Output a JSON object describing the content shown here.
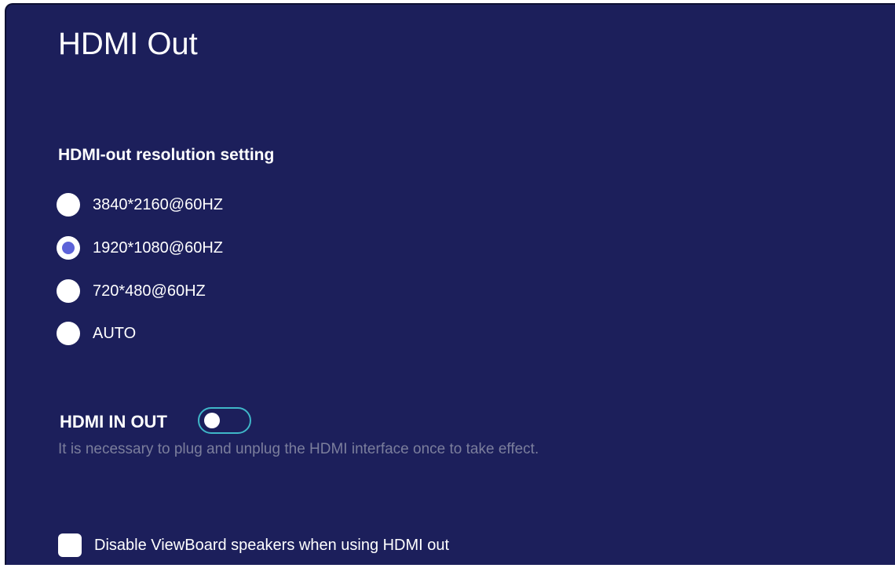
{
  "page": {
    "title": "HDMI Out"
  },
  "resolution": {
    "label": "HDMI-out resolution setting",
    "options": [
      {
        "label": "3840*2160@60HZ",
        "selected": false
      },
      {
        "label": "1920*1080@60HZ",
        "selected": true
      },
      {
        "label": "720*480@60HZ",
        "selected": false
      },
      {
        "label": "AUTO",
        "selected": false
      }
    ]
  },
  "hdmi_in_out": {
    "label": "HDMI IN OUT",
    "enabled": false,
    "hint": "It is necessary to plug and unplug the HDMI interface once to take effect."
  },
  "speakers": {
    "label": "Disable ViewBoard speakers when using HDMI out",
    "checked": false
  },
  "colors": {
    "background": "#1c1f5b",
    "radio_selected": "#5d63d8",
    "toggle_border": "#3fb6c8",
    "hint_text": "#7b7e9c"
  }
}
